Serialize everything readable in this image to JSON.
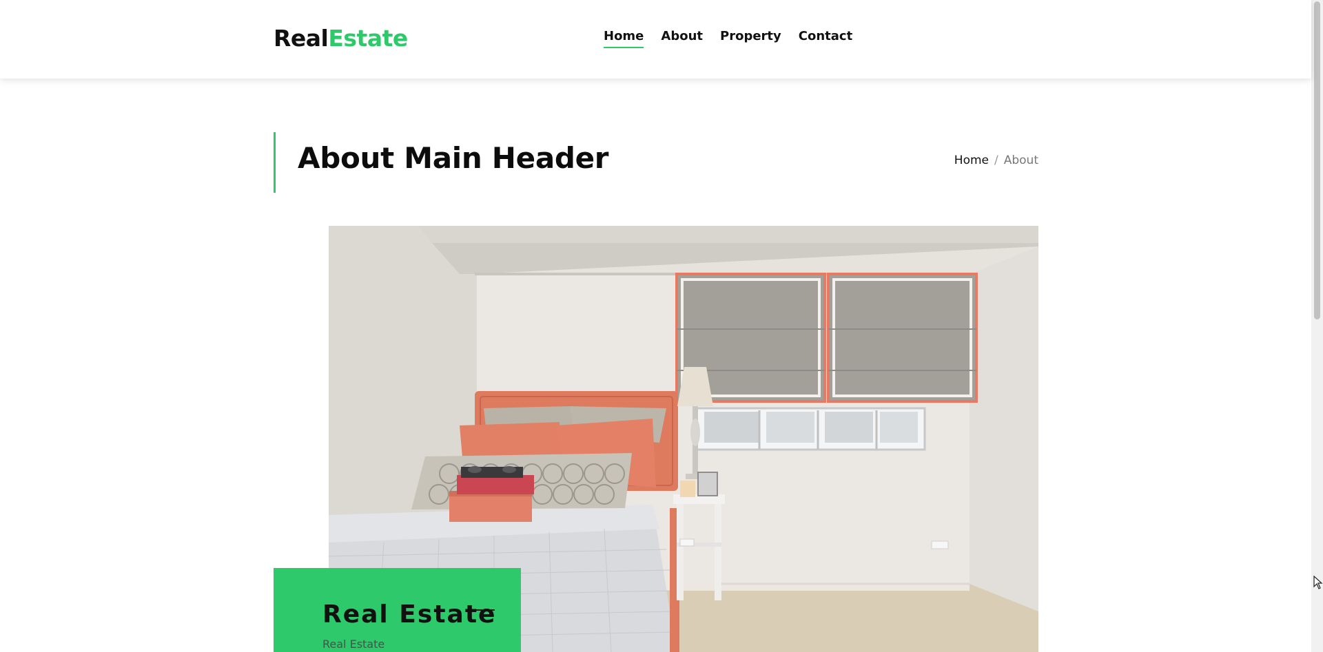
{
  "header": {
    "logo_part1": "Real",
    "logo_part2": "Estate",
    "nav": {
      "home": "Home",
      "about": "About",
      "property": "Property",
      "contact": "Contact"
    },
    "active_item": "Home"
  },
  "page": {
    "title": "About Main Header",
    "breadcrumb": {
      "home": "Home",
      "separator": "/",
      "current": "About"
    }
  },
  "hero": {
    "image_subject": "bedroom-photo"
  },
  "card": {
    "title": "Real Estate",
    "subtitle": "Real Estate"
  },
  "colors": {
    "accent": "#2dc96a",
    "text": "#111111",
    "muted": "#777777"
  }
}
